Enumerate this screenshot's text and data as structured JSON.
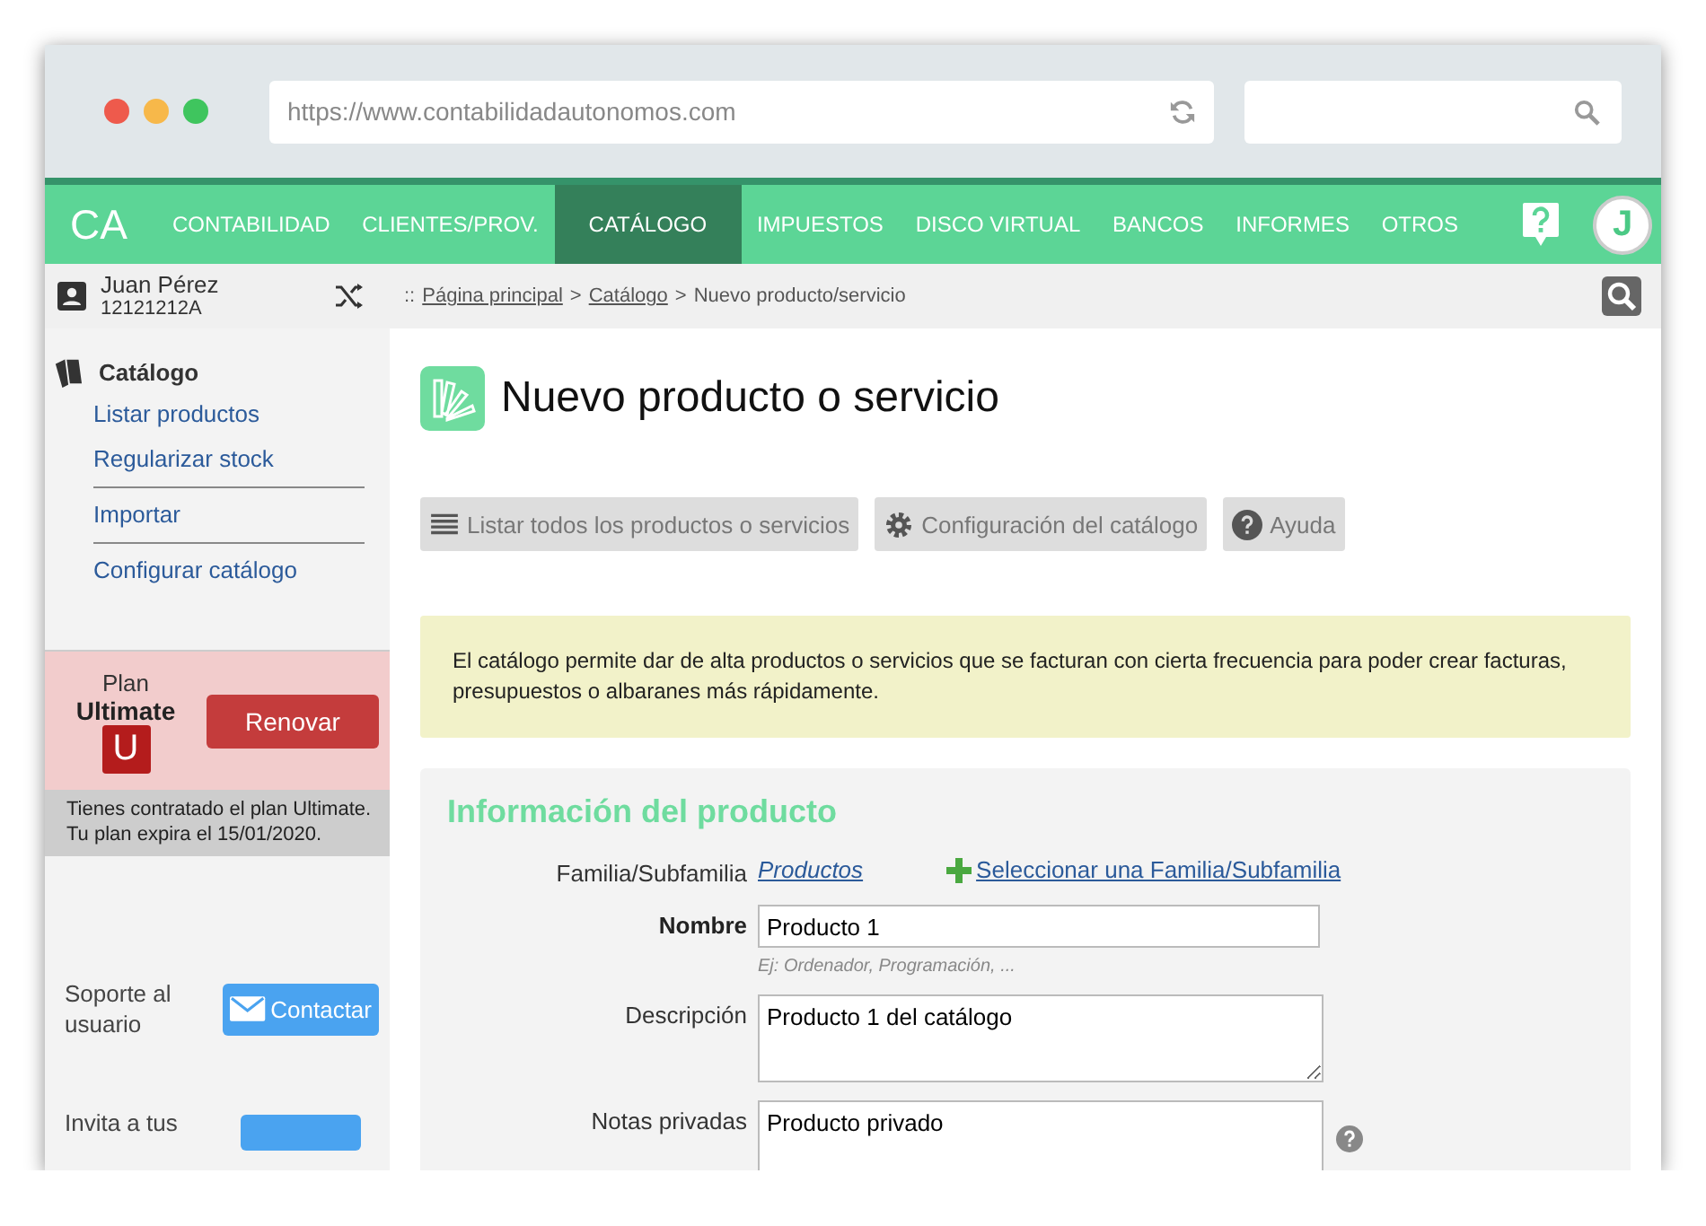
{
  "browser": {
    "url": "https://www.contabilidadautonomos.com"
  },
  "nav": {
    "logo": "CA",
    "items": [
      {
        "label": "CONTABILIDAD",
        "selected": false
      },
      {
        "label": "CLIENTES/PROV.",
        "selected": false
      },
      {
        "label": "CATÁLOGO",
        "selected": true
      },
      {
        "label": "IMPUESTOS",
        "selected": false
      },
      {
        "label": "DISCO VIRTUAL",
        "selected": false
      },
      {
        "label": "BANCOS",
        "selected": false
      },
      {
        "label": "INFORMES",
        "selected": false
      },
      {
        "label": "OTROS",
        "selected": false
      }
    ],
    "avatar": "J"
  },
  "user": {
    "name": "Juan Pérez",
    "id": "12121212A"
  },
  "breadcrumb": [
    {
      "kind": "sep",
      "text": "::"
    },
    {
      "kind": "link",
      "text": "Página principal"
    },
    {
      "kind": "sep",
      "text": ">"
    },
    {
      "kind": "link",
      "text": "Catálogo"
    },
    {
      "kind": "sep",
      "text": ">"
    },
    {
      "kind": "text",
      "text": "Nuevo producto/servicio"
    }
  ],
  "sidebar": {
    "title": "Catálogo",
    "groups": [
      [
        "Listar productos",
        "Regularizar stock"
      ],
      [
        "Importar"
      ],
      [
        "Configurar catálogo"
      ]
    ],
    "plan": {
      "label": "Plan",
      "name": "Ultimate",
      "badge": "U",
      "button": "Renovar",
      "notice": "Tienes contratado el plan Ultimate. Tu plan expira el 15/01/2020."
    },
    "support": {
      "label": "Soporte al usuario",
      "button": "Contactar"
    },
    "invite": {
      "label": "Invita a tus"
    }
  },
  "page": {
    "title": "Nuevo producto o servicio",
    "actions": [
      {
        "kind": "list",
        "label": "Listar todos los productos o servicios"
      },
      {
        "kind": "gear",
        "label": "Configuración del catálogo"
      },
      {
        "kind": "help",
        "label": "Ayuda"
      }
    ],
    "info": "El catálogo permite dar de alta productos o servicios que se facturan con cierta frecuencia para poder crear facturas, presupuestos o albaranes más rápidamente.",
    "section": {
      "title": "Información del producto",
      "family": {
        "label": "Familia/Subfamilia",
        "value": "Productos",
        "action": "Seleccionar una Familia/Subfamilia"
      },
      "fields": [
        {
          "kind": "input",
          "label": "Nombre",
          "required": true,
          "value": "Producto 1",
          "hint": "Ej: Ordenador, Programación, ..."
        },
        {
          "kind": "textarea",
          "label": "Descripción",
          "required": false,
          "value": "Producto 1 del catálogo"
        },
        {
          "kind": "textarea",
          "label": "Notas privadas",
          "required": false,
          "value": "Producto privado",
          "help": true
        }
      ]
    }
  }
}
